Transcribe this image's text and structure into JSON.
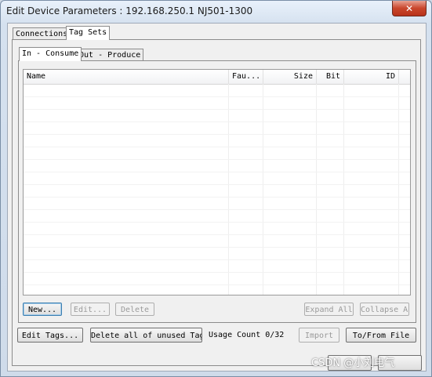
{
  "window": {
    "title": "Edit Device Parameters : 192.168.250.1 NJ501-1300",
    "close_glyph": "✕"
  },
  "tabs": [
    {
      "label": "Connections"
    },
    {
      "label": "Tag Sets"
    }
  ],
  "subtabs": [
    {
      "label": "In - Consume"
    },
    {
      "label": "Out - Produce"
    }
  ],
  "table": {
    "columns": [
      "Name",
      "Fau...",
      "Size",
      "Bit",
      "ID"
    ]
  },
  "list_buttons": {
    "new": "New...",
    "edit": "Edit...",
    "delete": "Delete",
    "expand_all": "Expand All",
    "collapse_all": "Collapse All"
  },
  "bottom": {
    "edit_tags": "Edit Tags...",
    "delete_unused": "Delete all of unused Tag Set",
    "usage_count": "Usage Count 0/32",
    "import": "Import",
    "to_from_file": "To/From File"
  },
  "footer": {
    "watermark": "CSDN @小刘电气"
  }
}
